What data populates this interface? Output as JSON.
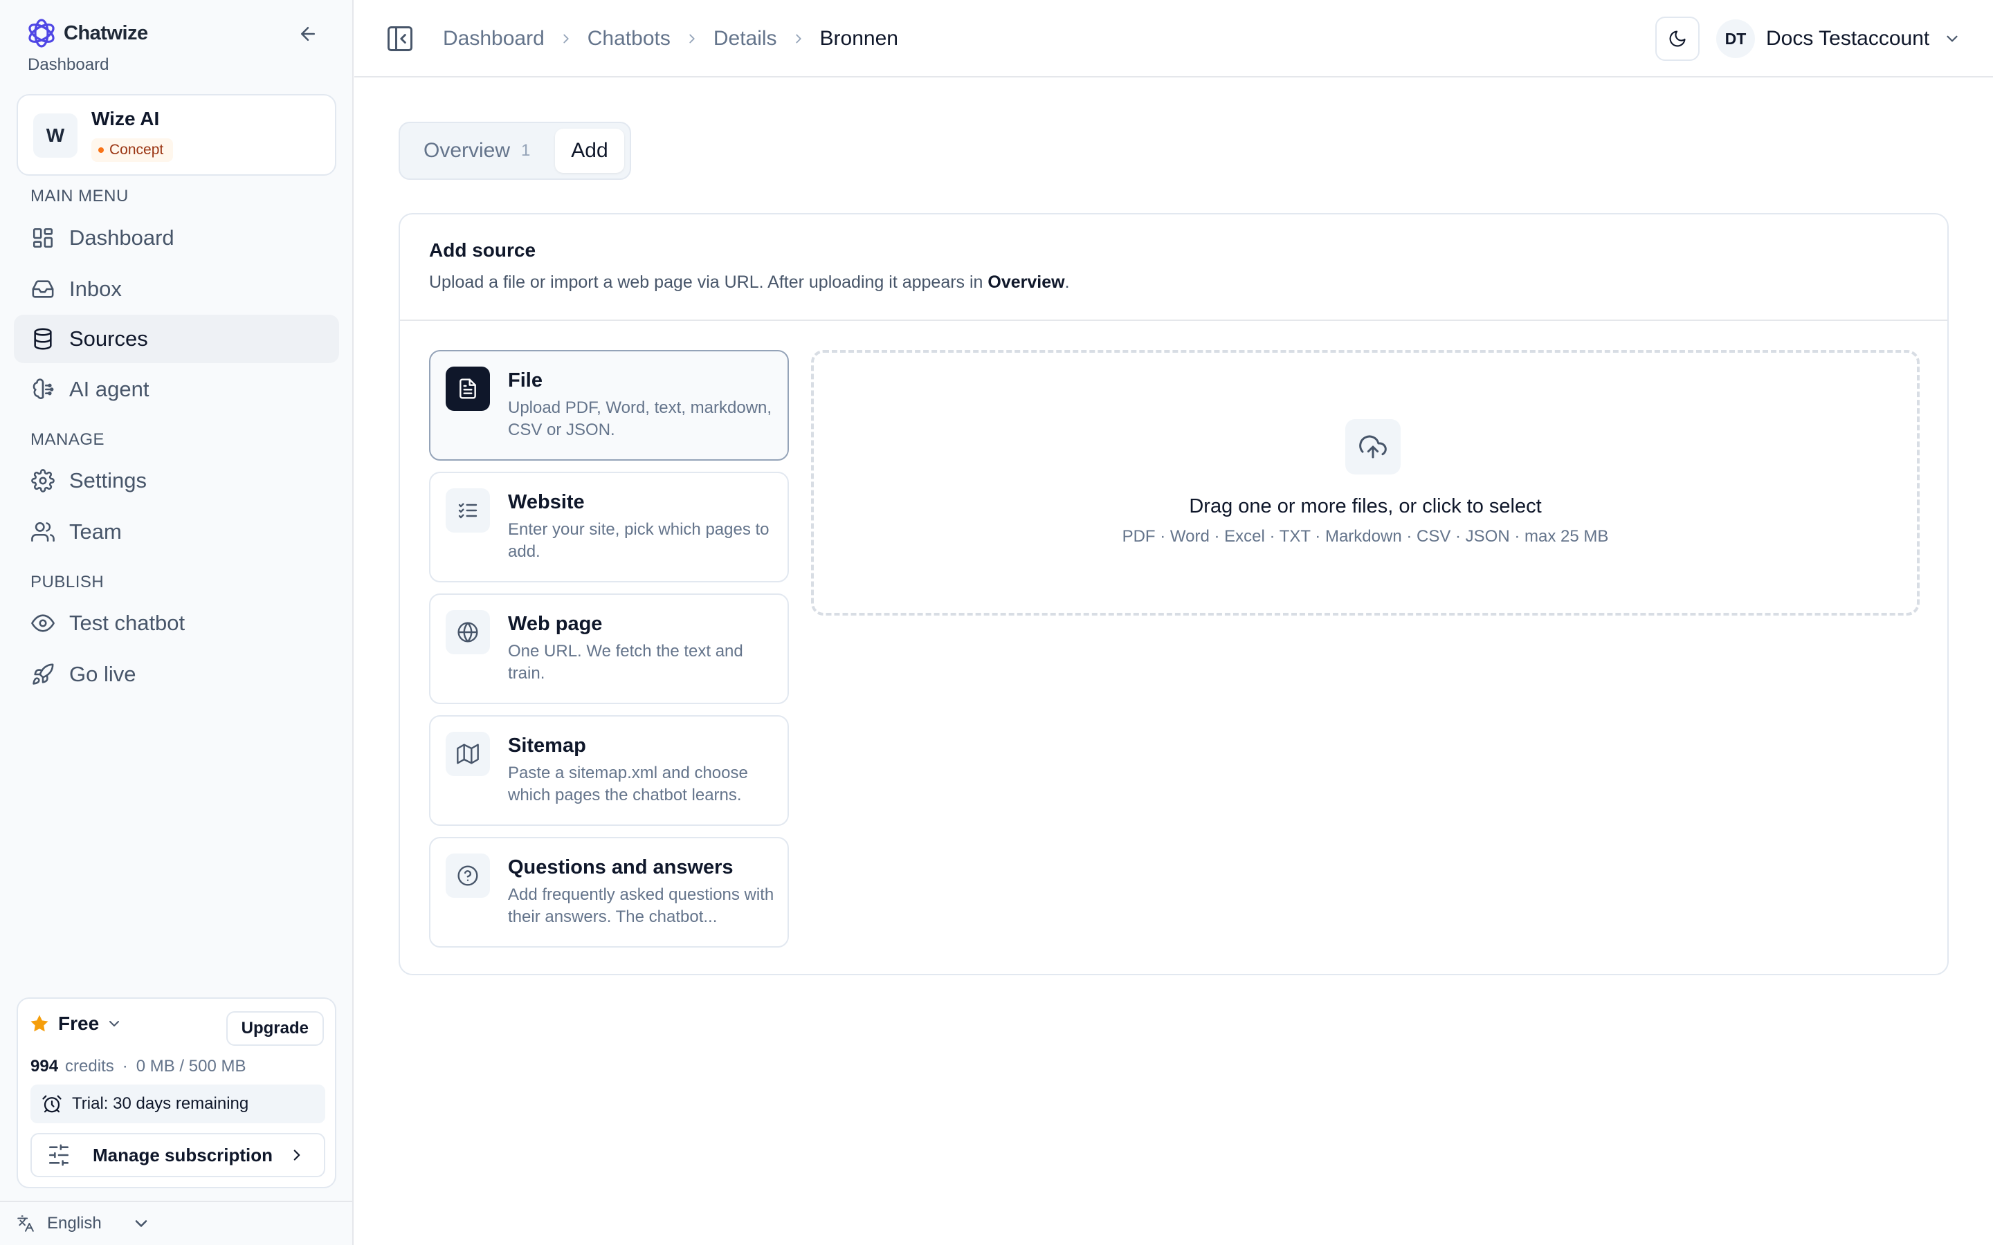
{
  "app": {
    "name": "Chatwize",
    "subtitle": "Dashboard"
  },
  "workspace": {
    "initial": "W",
    "name": "Wize AI",
    "status": "Concept"
  },
  "sidebar": {
    "sections": {
      "main": "MAIN MENU",
      "manage": "MANAGE",
      "publish": "PUBLISH"
    },
    "items": [
      {
        "label": "Dashboard",
        "icon": "layout-dashboard-icon"
      },
      {
        "label": "Inbox",
        "icon": "inbox-icon"
      },
      {
        "label": "Sources",
        "icon": "database-icon",
        "active": true
      },
      {
        "label": "AI agent",
        "icon": "brain-icon"
      },
      {
        "label": "Settings",
        "icon": "gear-icon"
      },
      {
        "label": "Team",
        "icon": "users-icon"
      },
      {
        "label": "Test chatbot",
        "icon": "eye-icon"
      },
      {
        "label": "Go live",
        "icon": "rocket-icon"
      }
    ]
  },
  "plan": {
    "name": "Free",
    "upgrade_label": "Upgrade",
    "credits": "994",
    "credits_label": "credits",
    "storage": "0 MB / 500 MB",
    "trial": "Trial: 30 days remaining",
    "manage_label": "Manage subscription"
  },
  "language": "English",
  "header": {
    "breadcrumb": [
      "Dashboard",
      "Chatbots",
      "Details",
      "Bronnen"
    ],
    "user": {
      "initials": "DT",
      "name": "Docs Testaccount"
    }
  },
  "tabs": {
    "overview_label": "Overview",
    "overview_count": "1",
    "add_label": "Add"
  },
  "add_source": {
    "title": "Add source",
    "description": "Upload a file or import a web page via URL. After uploading it appears in",
    "description_link": "Overview",
    "description_end": ".",
    "options": [
      {
        "title": "File",
        "description": "Upload PDF, Word, text, markdown, CSV or JSON.",
        "icon": "file-text-icon",
        "selected": true
      },
      {
        "title": "Website",
        "description": "Enter your site, pick which pages to add.",
        "icon": "list-checks-icon"
      },
      {
        "title": "Web page",
        "description": "One URL. We fetch the text and train.",
        "icon": "globe-icon"
      },
      {
        "title": "Sitemap",
        "description": "Paste a sitemap.xml and choose which pages the chatbot learns.",
        "icon": "map-icon"
      },
      {
        "title": "Questions and answers",
        "description": "Add frequently asked questions with their answers. The chatbot...",
        "icon": "help-circle-icon"
      }
    ],
    "dropzone": {
      "title": "Drag one or more files, or click to select",
      "formats": "PDF · Word · Excel · TXT · Markdown · CSV · JSON · max 25 MB",
      "icon": "cloud-upload-icon"
    }
  },
  "colors": {
    "accent": "#0f172a",
    "brand": "#4f46e5",
    "badge_bg": "#fff7ed",
    "badge_dot": "#f97316",
    "star": "#f59e0b"
  }
}
